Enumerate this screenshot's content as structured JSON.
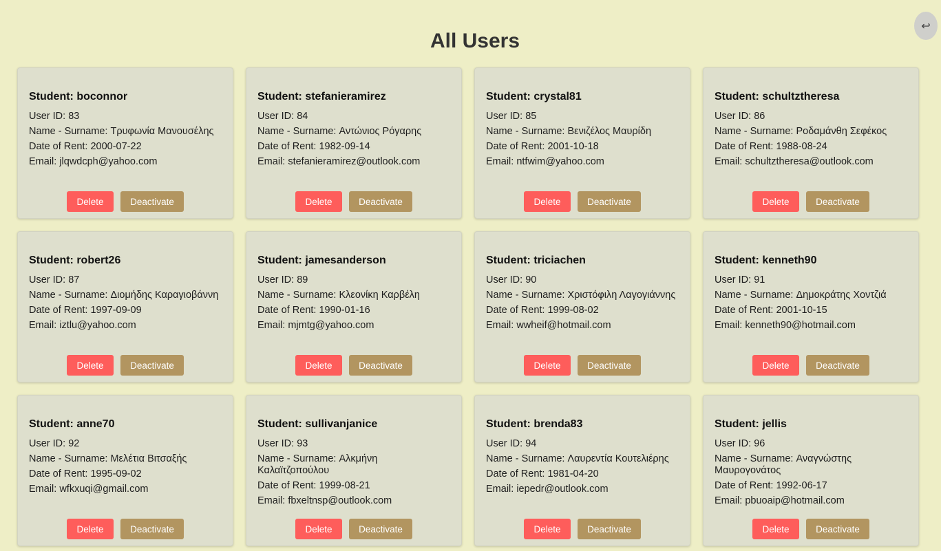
{
  "header": {
    "title": "All Users",
    "back_icon": "↩"
  },
  "labels": {
    "student_prefix": "Student: ",
    "user_id": "User ID: ",
    "name": "Name - Surname: ",
    "date": "Date of Rent: ",
    "email": "Email: ",
    "delete": "Delete",
    "deactivate": "Deactivate"
  },
  "colors": {
    "background": "#eeeec6",
    "card": "#dedfcd",
    "delete_button": "#fe5d5b",
    "deactivate_button": "#b29560"
  },
  "users": [
    {
      "username": "boconnor",
      "id": "83",
      "name": "Τρυφωνία Μανουσέλης",
      "date": "2000-07-22",
      "email": "jlqwdcph@yahoo.com"
    },
    {
      "username": "stefanieramirez",
      "id": "84",
      "name": "Αντώνιος Ρόγαρης",
      "date": "1982-09-14",
      "email": "stefanieramirez@outlook.com"
    },
    {
      "username": "crystal81",
      "id": "85",
      "name": "Βενιζέλος Μαυρίδη",
      "date": "2001-10-18",
      "email": "ntfwim@yahoo.com"
    },
    {
      "username": "schultztheresa",
      "id": "86",
      "name": "Ροδαμάνθη Σεφέκος",
      "date": "1988-08-24",
      "email": "schultztheresa@outlook.com"
    },
    {
      "username": "robert26",
      "id": "87",
      "name": "Διομήδης Καραγιοβάννη",
      "date": "1997-09-09",
      "email": "iztlu@yahoo.com"
    },
    {
      "username": "jamesanderson",
      "id": "89",
      "name": "Κλεονίκη Καρβέλη",
      "date": "1990-01-16",
      "email": "mjmtg@yahoo.com"
    },
    {
      "username": "triciachen",
      "id": "90",
      "name": "Χριστόφιλη Λαγογιάννης",
      "date": "1999-08-02",
      "email": "wwheif@hotmail.com"
    },
    {
      "username": "kenneth90",
      "id": "91",
      "name": "Δημοκράτης Χοντζιά",
      "date": "2001-10-15",
      "email": "kenneth90@hotmail.com"
    },
    {
      "username": "anne70",
      "id": "92",
      "name": "Μελέτια Βιτσαξής",
      "date": "1995-09-02",
      "email": "wfkxuqi@gmail.com"
    },
    {
      "username": "sullivanjanice",
      "id": "93",
      "name": "Αλκμήνη Καλαϊτζοπούλου",
      "date": "1999-08-21",
      "email": "fbxeltnsp@outlook.com"
    },
    {
      "username": "brenda83",
      "id": "94",
      "name": "Λαυρεντία Κουτελιέρης",
      "date": "1981-04-20",
      "email": "iepedr@outlook.com"
    },
    {
      "username": "jellis",
      "id": "96",
      "name": "Αναγνώστης Μαυρογονάτος",
      "date": "1992-06-17",
      "email": "pbuoaip@hotmail.com"
    }
  ]
}
